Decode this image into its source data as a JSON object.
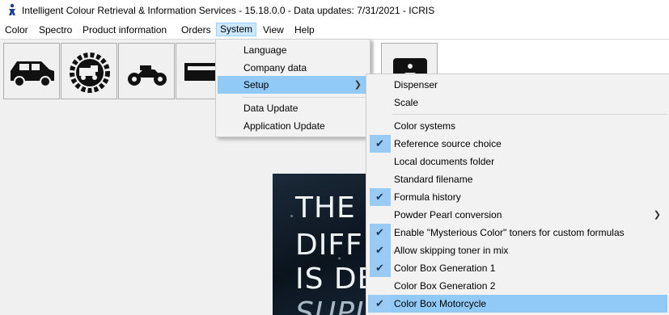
{
  "window": {
    "title": "Intelligent Colour Retrieval & Information Services - 15.18.0.0 - Data updates: 7/31/2021 - ICRIS"
  },
  "menubar": {
    "items": [
      "Color",
      "Spectro",
      "Product information",
      "Orders",
      "System",
      "View",
      "Help"
    ],
    "active": "System"
  },
  "toolbar": {
    "buttons": [
      "car-icon",
      "truck-gear-icon",
      "motorcycle-icon",
      "partial-icon",
      "device-icon"
    ]
  },
  "banner": {
    "lines": [
      "THE",
      "DIFFI",
      "IS DE",
      "SUPI"
    ]
  },
  "system_menu": {
    "items": [
      "Language",
      "Company data",
      "Setup",
      "Data Update",
      "Application Update"
    ],
    "highlighted": "Setup"
  },
  "setup_menu": {
    "items": [
      {
        "label": "Dispenser",
        "checked": false
      },
      {
        "label": "Scale",
        "checked": false
      },
      {
        "label": "Color systems",
        "checked": false
      },
      {
        "label": "Reference source choice",
        "checked": true
      },
      {
        "label": "Local documents folder",
        "checked": false
      },
      {
        "label": "Standard filename",
        "checked": false
      },
      {
        "label": "Formula history",
        "checked": true
      },
      {
        "label": "Powder Pearl conversion",
        "checked": false,
        "submenu": true
      },
      {
        "label": "Enable \"Mysterious Color\" toners for custom formulas",
        "checked": true
      },
      {
        "label": "Allow skipping toner in mix",
        "checked": true
      },
      {
        "label": "Color Box Generation 1",
        "checked": true
      },
      {
        "label": "Color Box Generation 2",
        "checked": false
      },
      {
        "label": "Color Box Motorcycle",
        "checked": true,
        "highlighted": true
      }
    ]
  },
  "colors": {
    "highlight": "#91c9f7",
    "check_bg": "#99cbf5",
    "menu_active": "#cce8ff"
  }
}
